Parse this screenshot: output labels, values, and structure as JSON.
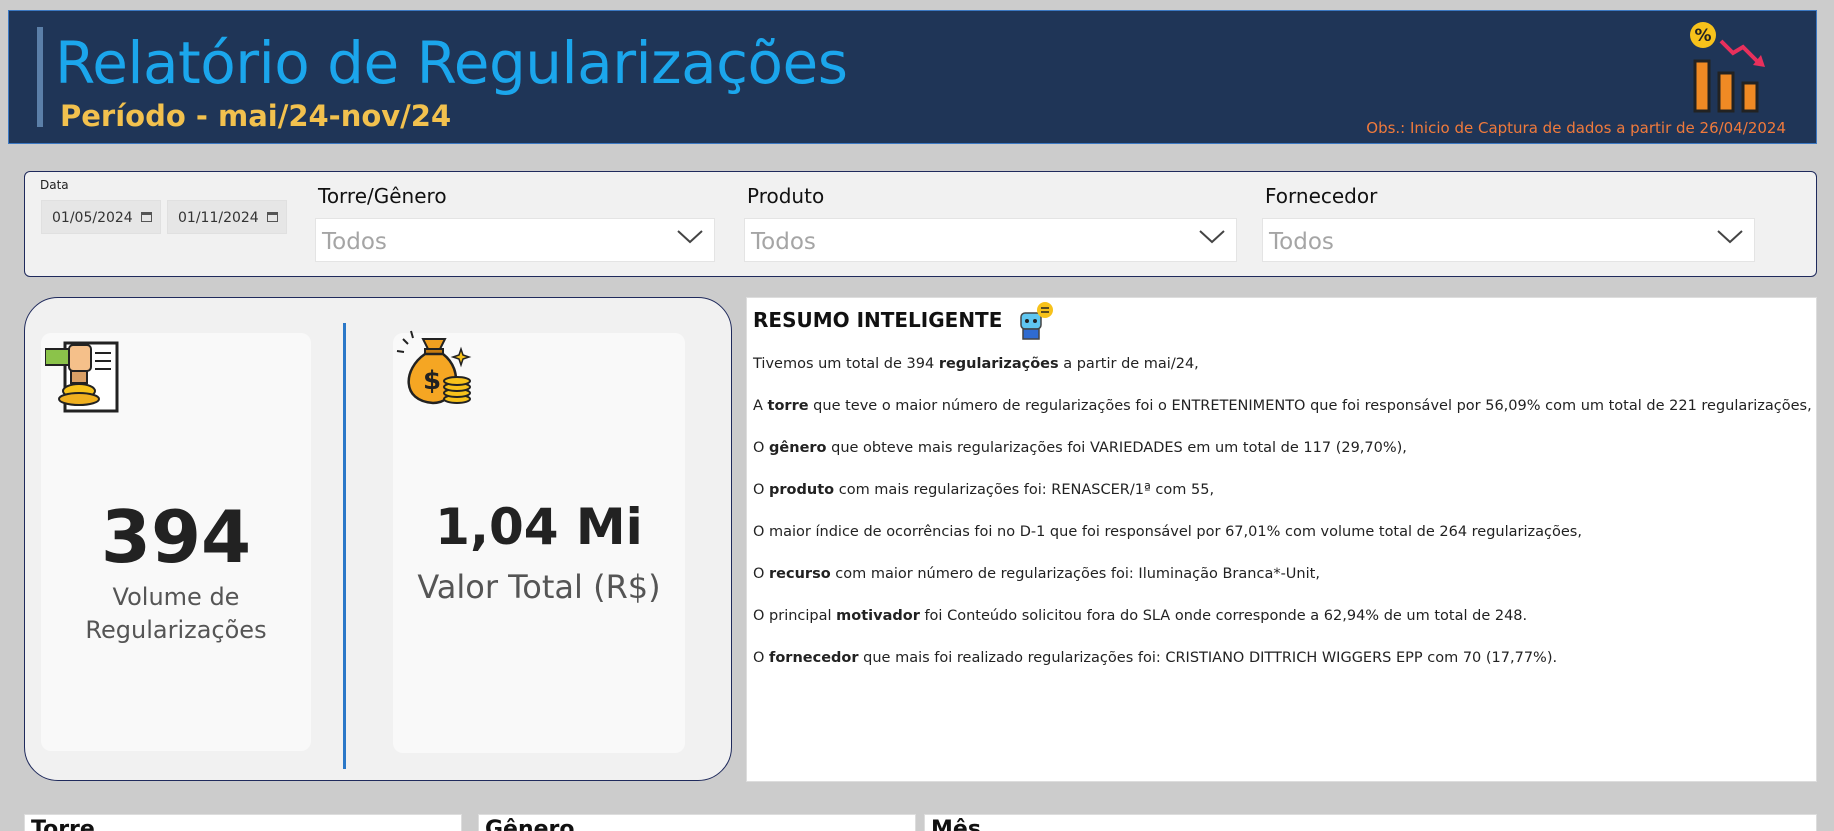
{
  "header": {
    "title": "Relatório de Regularizações",
    "subtitle": "Período - mai/24-nov/24",
    "obs": "Obs.: Inicio de Captura de dados a partir de 26/04/2024"
  },
  "filters": {
    "date_label": "Data",
    "date_start": "01/05/2024",
    "date_end": "01/11/2024",
    "slicers": [
      {
        "label": "Torre/Gênero",
        "value": "Todos"
      },
      {
        "label": "Produto",
        "value": "Todos"
      },
      {
        "label": "Fornecedor",
        "value": "Todos"
      }
    ]
  },
  "kpis": [
    {
      "value": "394",
      "label_line1": "Volume de",
      "label_line2": "Regularizações",
      "icon": "stamp-document-icon"
    },
    {
      "value": "1,04 Mi",
      "label": "Valor Total (R$)",
      "icon": "money-bag-icon"
    }
  ],
  "summary": {
    "title": "RESUMO INTELIGENTE",
    "lines": [
      {
        "pre": "Tivemos um total de 394 ",
        "bold": "regularizações",
        "post": " a partir de mai/24,"
      },
      {
        "pre": "A ",
        "bold": "torre",
        "post": " que teve o maior número de regularizações foi o ENTRETENIMENTO que foi responsável por 56,09% com um total de 221 regularizações,"
      },
      {
        "pre": "O ",
        "bold": "gênero",
        "post": " que obteve mais regularizações foi VARIEDADES em um total de 117 (29,70%),"
      },
      {
        "pre": "O ",
        "bold": "produto",
        "post": " com mais regularizações foi: RENASCER/1ª com 55,"
      },
      {
        "pre": "O maior índice de ocorrências foi no D-1 que foi responsável por 67,01% com volume total de 264 regularizações,",
        "bold": "",
        "post": ""
      },
      {
        "pre": "O ",
        "bold": "recurso",
        "post": " com maior número de regularizações foi: Iluminação Branca*-Unit,"
      },
      {
        "pre": "O principal ",
        "bold": "motivador",
        "post": " foi Conteúdo solicitou fora do SLA onde corresponde a 62,94% de um total de 248."
      },
      {
        "pre": "O ",
        "bold": "fornecedor",
        "post": " que mais foi realizado regularizações foi: CRISTIANO DITTRICH WIGGERS EPP com 70 (17,77%)."
      }
    ]
  },
  "bottom_cards": [
    {
      "title": "Torre"
    },
    {
      "title": "Gênero"
    },
    {
      "title": "Mês"
    }
  ],
  "colors": {
    "header_bg": "#1f3557",
    "title": "#1ba6ec",
    "subtitle": "#f2c14e",
    "obs": "#f07a3c",
    "divider": "#2b78c8"
  }
}
